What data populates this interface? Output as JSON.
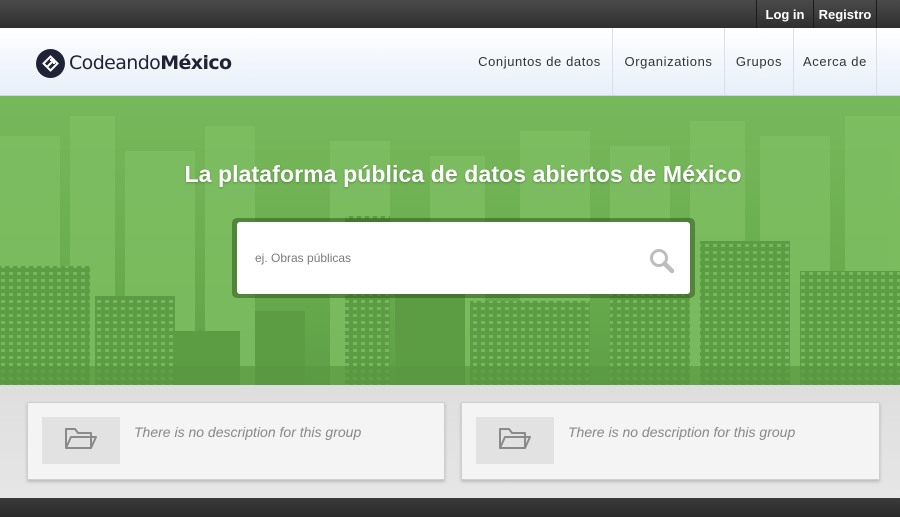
{
  "account": {
    "login_label": "Log in",
    "register_label": "Registro"
  },
  "brand": {
    "name_regular": "Codeando",
    "name_bold": "México",
    "icon": "diamond-arrow-logo-icon"
  },
  "nav": {
    "items": [
      {
        "label": "Conjuntos de datos"
      },
      {
        "label": "Organizations"
      },
      {
        "label": "Grupos"
      },
      {
        "label": "Acerca de"
      }
    ]
  },
  "hero": {
    "title": "La plataforma pública de datos abiertos de México",
    "search": {
      "placeholder": "ej. Obras públicas",
      "value": "",
      "icon": "search-icon"
    }
  },
  "groups": [
    {
      "description": "There is no description for this group",
      "icon": "folder-icon"
    },
    {
      "description": "There is no description for this group",
      "icon": "folder-icon"
    }
  ],
  "colors": {
    "hero_green": "#6cb052",
    "account_bar": "#3a3a3a",
    "brand_dark": "#1f2335"
  }
}
